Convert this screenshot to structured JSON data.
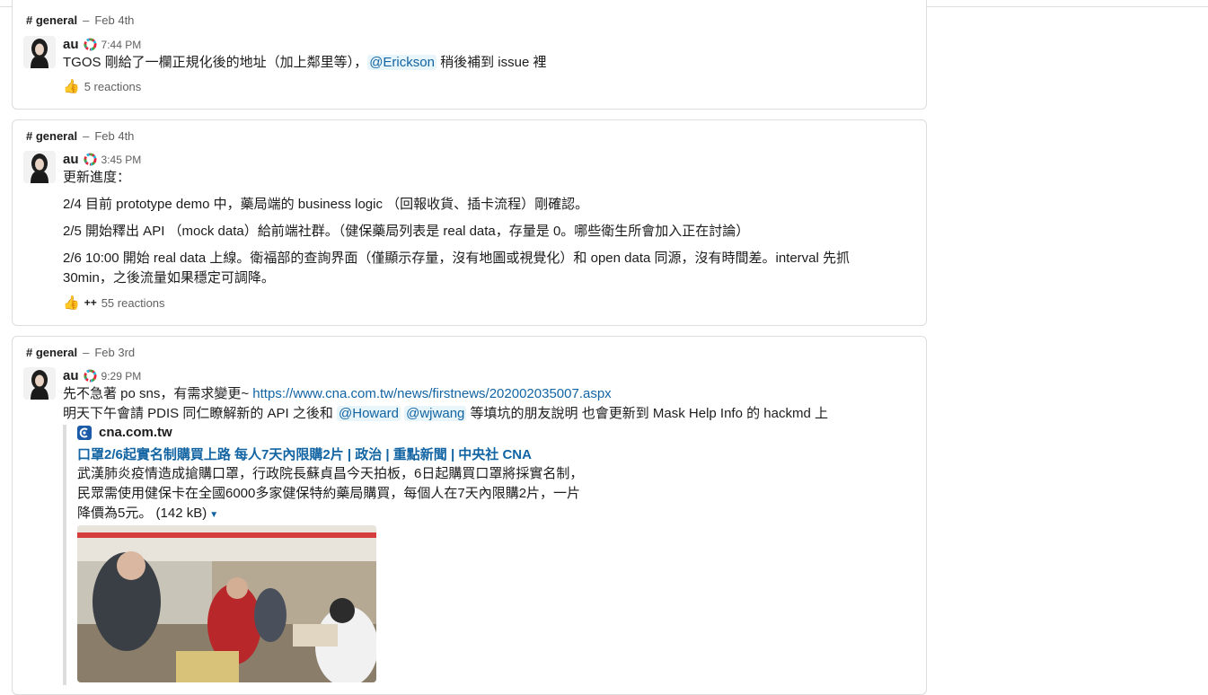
{
  "colors": {
    "link": "#1264a3",
    "mention_bg": "#e8f5fa",
    "border": "#dddddd",
    "muted": "#616061"
  },
  "messages": [
    {
      "channel": "# general",
      "date": "Feb 4th",
      "author": "au",
      "time": "7:44 PM",
      "lines": [
        {
          "parts": [
            {
              "text": "TGOS 剛給了一欄正規化後的地址（加上鄰里等），"
            },
            {
              "text": "@Erickson",
              "type": "mention"
            },
            {
              "text": " 稍後補到 issue 裡"
            }
          ]
        }
      ],
      "reaction_emoji": "👍",
      "reaction_extra": "",
      "reactions": "5 reactions"
    },
    {
      "channel": "# general",
      "date": "Feb 4th",
      "author": "au",
      "time": "3:45 PM",
      "lines": [
        {
          "parts": [
            {
              "text": "更新進度："
            }
          ]
        },
        {
          "parts": [
            {
              "text": "2/4 目前 prototype demo 中，藥局端的 business logic （回報收貨、插卡流程）剛確認。"
            }
          ]
        },
        {
          "parts": [
            {
              "text": "2/5 開始釋出 API （mock data）給前端社群。（健保藥局列表是 real data，存量是 0。哪些衛生所會加入正在討論）"
            }
          ]
        },
        {
          "parts": [
            {
              "text": "2/6 10:00 開始 real data 上線。衛福部的查詢界面（僅顯示存量，沒有地圖或視覺化）和 open data 同源，沒有時間差。interval 先抓"
            }
          ]
        },
        {
          "parts": [
            {
              "text": "30min，之後流量如果穩定可調降。"
            }
          ]
        }
      ],
      "reaction_emoji": "👍",
      "reaction_extra": "++",
      "reactions": "55 reactions"
    },
    {
      "channel": "# general",
      "date": "Feb 3rd",
      "author": "au",
      "time": "9:29 PM",
      "lines": [
        {
          "parts": [
            {
              "text": "先不急著 po sns，有需求變更~ "
            },
            {
              "text": "https://www.cna.com.tw/news/firstnews/202002035007.aspx",
              "type": "link"
            }
          ]
        },
        {
          "parts": [
            {
              "text": "明天下午會請 PDIS 同仁瞭解新的 API 之後和 "
            },
            {
              "text": "@Howard",
              "type": "mention"
            },
            {
              "text": " "
            },
            {
              "text": "@wjwang",
              "type": "mention"
            },
            {
              "text": " 等填坑的朋友說明 也會更新到 Mask Help Info 的 hackmd 上"
            }
          ]
        }
      ],
      "unfurl": {
        "site": "cna.com.tw",
        "title": "口罩2/6起實名制購買上路 每人7天內限購2片 | 政治 | 重點新聞 | 中央社 CNA",
        "desc": [
          "武漢肺炎疫情造成搶購口罩，行政院長蘇貞昌今天拍板，6日起購買口罩將採實名制，",
          "民眾需使用健保卡在全國6000多家健保特約藥局購買，每個人在7天內限購2片，一片",
          "降價為5元。"
        ],
        "size": "(142 kB)"
      }
    }
  ]
}
